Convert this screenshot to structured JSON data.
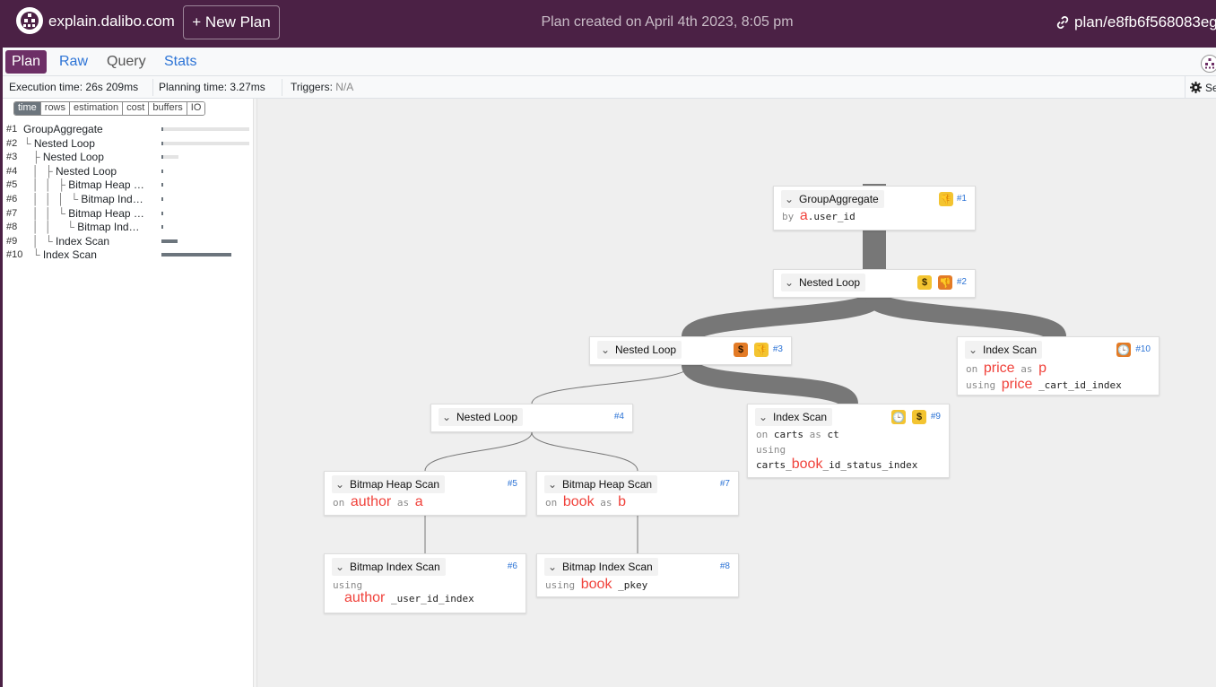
{
  "header": {
    "brand": "explain.dalibo.com",
    "new_plan": "+ New Plan",
    "created": "Plan created on April 4th 2023, 8:05 pm",
    "permalink": "plan/e8fb6f568083eg"
  },
  "tabs": [
    {
      "label": "Plan"
    },
    {
      "label": "Raw"
    },
    {
      "label": "Query"
    },
    {
      "label": "Stats"
    }
  ],
  "stats": {
    "execution_label": "Execution time:",
    "execution_value": "26s 209ms",
    "planning_label": "Planning time:",
    "planning_value": "3.27ms",
    "triggers_label": "Triggers:",
    "triggers_value": "N/A",
    "settings_label": "Se"
  },
  "sidebar": {
    "modes": [
      "time",
      "rows",
      "estimation",
      "cost",
      "buffers",
      "IO"
    ],
    "active_mode": "time",
    "rows": [
      {
        "num": "#1",
        "guide": "",
        "name": "GroupAggregate",
        "fraction": 0.02
      },
      {
        "num": "#2",
        "guide": "└ ",
        "name": "Nested Loop",
        "fraction": 0.02
      },
      {
        "num": "#3",
        "guide": "   ├ ",
        "name": "Nested Loop",
        "fraction": 0.02
      },
      {
        "num": "#4",
        "guide": "   │  ├ ",
        "name": "Nested Loop",
        "fraction": 0.02
      },
      {
        "num": "#5",
        "guide": "   │  │  ├ ",
        "name": "Bitmap Heap …",
        "fraction": 0.01
      },
      {
        "num": "#6",
        "guide": "   │  │  │  └ ",
        "name": "Bitmap Ind…",
        "fraction": 0.01
      },
      {
        "num": "#7",
        "guide": "   │  │  └ ",
        "name": "Bitmap Heap …",
        "fraction": 0.01
      },
      {
        "num": "#8",
        "guide": "   │  │     └ ",
        "name": "Bitmap Ind…",
        "fraction": 0.01
      },
      {
        "num": "#9",
        "guide": "   │  └ ",
        "name": "Index Scan",
        "fraction": 0.18
      },
      {
        "num": "#10",
        "guide": "   └ ",
        "name": "Index Scan",
        "fraction": 0.8
      }
    ]
  },
  "nodes": {
    "n1": {
      "title": "GroupAggregate",
      "id": "#1",
      "by": "by",
      "red": "a",
      "rest": ".user_id"
    },
    "n2": {
      "title": "Nested Loop",
      "id": "#2"
    },
    "n3": {
      "title": "Nested Loop",
      "id": "#3"
    },
    "n4": {
      "title": "Nested Loop",
      "id": "#4"
    },
    "n5": {
      "title": "Bitmap Heap Scan",
      "id": "#5",
      "on": "on",
      "table": "author",
      "as": "as",
      "alias": "a"
    },
    "n6": {
      "title": "Bitmap Index Scan",
      "id": "#6",
      "using": "using",
      "red": "author",
      "rest": "_user_id_index"
    },
    "n7": {
      "title": "Bitmap Heap Scan",
      "id": "#7",
      "on": "on",
      "table": "book",
      "as": "as",
      "alias": "b"
    },
    "n8": {
      "title": "Bitmap Index Scan",
      "id": "#8",
      "using": "using",
      "red": "book",
      "rest": "_pkey"
    },
    "n9": {
      "title": "Index Scan",
      "id": "#9",
      "on": "on",
      "table": "carts",
      "as": "as",
      "alias": "ct",
      "using": "using",
      "idx_pre": "carts_",
      "idx_red": "book",
      "idx_post": "_id_status_index"
    },
    "n10": {
      "title": "Index Scan",
      "id": "#10",
      "on": "on",
      "table": "price",
      "as": "as",
      "alias": "p",
      "using": "using",
      "idx_red": "price",
      "idx_post": "_cart_id_index"
    }
  },
  "badge_icons": {
    "thumbs_down": "👎",
    "dollar": "$",
    "clock": "🕒"
  },
  "colors": {
    "header_bg": "#4b2145",
    "active_tab": "#6d2f66",
    "link": "#2d74d6",
    "warn_yellow": "#f3c431",
    "warn_orange": "#e37b26",
    "highlight_red": "#f0423b",
    "edge": "#777777"
  }
}
